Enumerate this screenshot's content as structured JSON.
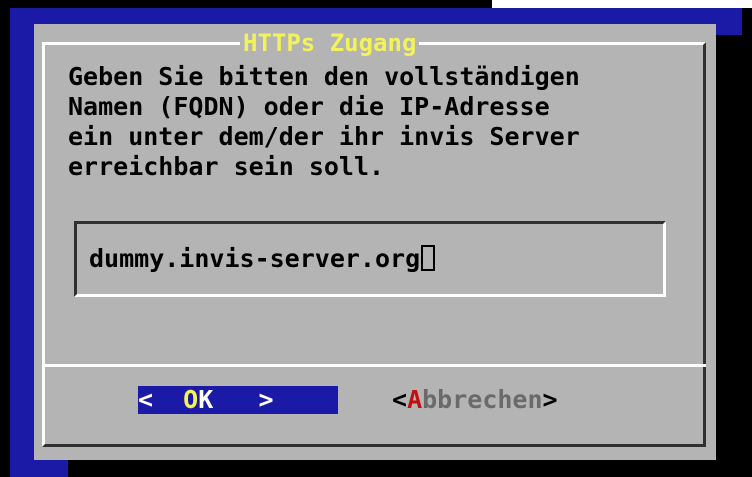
{
  "dialog": {
    "title": "HTTPs Zugang",
    "message_lines": [
      "Geben Sie bitten den vollständigen",
      "Namen (FQDN) oder die IP-Adresse",
      "ein unter dem/der ihr invis Server",
      "erreichbar sein soll."
    ],
    "input_value": "dummy.invis-server.org"
  },
  "buttons": {
    "ok": {
      "left": "<",
      "space1": "  ",
      "hotkey": "O",
      "rest": "K",
      "space2": "   ",
      "right": ">"
    },
    "cancel": {
      "left": "<",
      "hotkey": "A",
      "rest": "bbrechen",
      "right": ">"
    }
  },
  "colors": {
    "background": "#1a1aa6",
    "dialog": "#b4b4b4",
    "title": "#f2f25a",
    "hotkey_cancel": "#c01010"
  }
}
